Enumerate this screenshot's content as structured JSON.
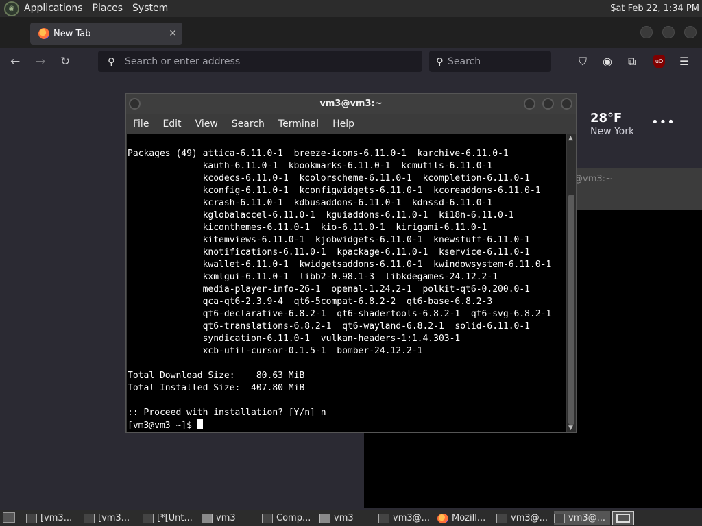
{
  "top_panel": {
    "menus": [
      "Applications",
      "Places",
      "System"
    ],
    "clock": "Sat Feb 22,  1:34 PM"
  },
  "firefox": {
    "tab_title": "New Tab",
    "url_placeholder": "Search or enter address",
    "search_placeholder": "Search",
    "weather": {
      "temp": "28°F",
      "city": "New York"
    },
    "ublock_badge": "uO"
  },
  "bg_terminal": {
    "title": "@vm3:~"
  },
  "terminal": {
    "title": "vm3@vm3:~",
    "menu": [
      "File",
      "Edit",
      "View",
      "Search",
      "Terminal",
      "Help"
    ],
    "lines": [
      "Packages (49) attica-6.11.0-1  breeze-icons-6.11.0-1  karchive-6.11.0-1",
      "              kauth-6.11.0-1  kbookmarks-6.11.0-1  kcmutils-6.11.0-1",
      "              kcodecs-6.11.0-1  kcolorscheme-6.11.0-1  kcompletion-6.11.0-1",
      "              kconfig-6.11.0-1  kconfigwidgets-6.11.0-1  kcoreaddons-6.11.0-1",
      "              kcrash-6.11.0-1  kdbusaddons-6.11.0-1  kdnssd-6.11.0-1",
      "              kglobalaccel-6.11.0-1  kguiaddons-6.11.0-1  ki18n-6.11.0-1",
      "              kiconthemes-6.11.0-1  kio-6.11.0-1  kirigami-6.11.0-1",
      "              kitemviews-6.11.0-1  kjobwidgets-6.11.0-1  knewstuff-6.11.0-1",
      "              knotifications-6.11.0-1  kpackage-6.11.0-1  kservice-6.11.0-1",
      "              kwallet-6.11.0-1  kwidgetsaddons-6.11.0-1  kwindowsystem-6.11.0-1",
      "              kxmlgui-6.11.0-1  libb2-0.98.1-3  libkdegames-24.12.2-1",
      "              media-player-info-26-1  openal-1.24.2-1  polkit-qt6-0.200.0-1",
      "              qca-qt6-2.3.9-4  qt6-5compat-6.8.2-2  qt6-base-6.8.2-3",
      "              qt6-declarative-6.8.2-1  qt6-shadertools-6.8.2-1  qt6-svg-6.8.2-1",
      "              qt6-translations-6.8.2-1  qt6-wayland-6.8.2-1  solid-6.11.0-1",
      "              syndication-6.11.0-1  vulkan-headers-1:1.4.303-1",
      "              xcb-util-cursor-0.1.5-1  bomber-24.12.2-1",
      "",
      "Total Download Size:    80.63 MiB",
      "Total Installed Size:  407.80 MiB",
      "",
      ":: Proceed with installation? [Y/n] n"
    ],
    "prompt": "[vm3@vm3 ~]$ "
  },
  "taskbar": [
    {
      "label": "[vm3...",
      "icon": "terminal-icon"
    },
    {
      "label": "[vm3...",
      "icon": "terminal-icon"
    },
    {
      "label": "[*[Unt...",
      "icon": "editor-icon"
    },
    {
      "label": "vm3",
      "icon": "folder-icon"
    },
    {
      "label": "Comp...",
      "icon": "computer-icon"
    },
    {
      "label": "vm3",
      "icon": "folder-icon"
    },
    {
      "label": "vm3@...",
      "icon": "terminal-icon"
    },
    {
      "label": "Mozill...",
      "icon": "firefox-icon"
    },
    {
      "label": "vm3@...",
      "icon": "terminal-icon"
    },
    {
      "label": "vm3@...",
      "icon": "terminal-icon",
      "active": true
    }
  ]
}
